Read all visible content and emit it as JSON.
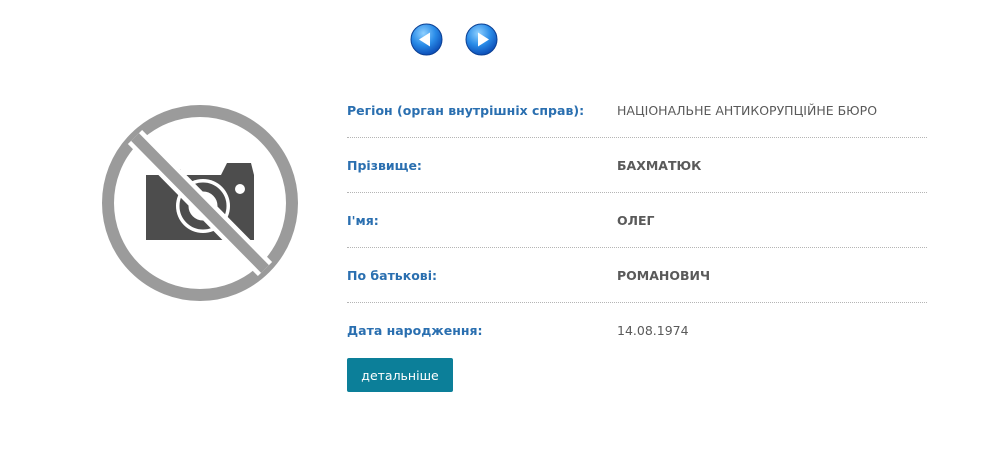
{
  "navigation": {
    "prev_icon": "arrow-left-circle-icon",
    "next_icon": "arrow-right-circle-icon",
    "accent_color": "#1f6fd6"
  },
  "photo": {
    "icon": "no-photo-camera-icon"
  },
  "fields": [
    {
      "label": "Регіон (орган внутрішніх справ):",
      "value": "НАЦІОНАЛЬНЕ АНТИКОРУПЦІЙНЕ БЮРО"
    },
    {
      "label": "Прізвище:",
      "value": "БАХМАТЮК"
    },
    {
      "label": "І'мя:",
      "value": "ОЛЕГ"
    },
    {
      "label": "По батькові:",
      "value": "РОМАНОВИЧ"
    },
    {
      "label": "Дата народження:",
      "value": "14.08.1974"
    }
  ],
  "details_button": {
    "label": "детальніше",
    "color": "#0c7f99"
  }
}
